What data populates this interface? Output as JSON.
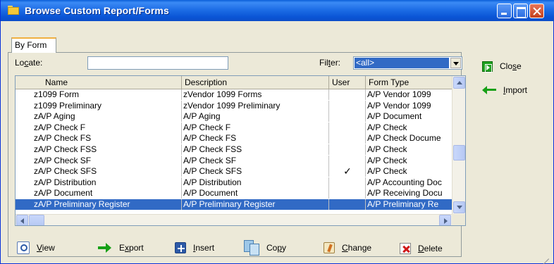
{
  "window": {
    "title": "Browse Custom Report/Forms"
  },
  "tabs": [
    {
      "label": "By Form"
    }
  ],
  "locate": {
    "label_pre": "Lo",
    "label_u": "c",
    "label_post": "ate:",
    "value": ""
  },
  "filter": {
    "label_pre": "Fil",
    "label_u": "t",
    "label_post": "er:",
    "value": "<all>"
  },
  "grid": {
    "columns": [
      "Name",
      "Description",
      "User",
      "Form Type"
    ],
    "rows": [
      {
        "name": "z1099 Form",
        "description": "zVendor 1099 Forms",
        "user": "",
        "form_type": "A/P Vendor 1099"
      },
      {
        "name": "z1099 Preliminary",
        "description": "zVendor 1099 Preliminary",
        "user": "",
        "form_type": "A/P Vendor 1099"
      },
      {
        "name": "zA/P Aging",
        "description": "A/P Aging",
        "user": "",
        "form_type": "A/P Document"
      },
      {
        "name": "zA/P Check F",
        "description": "A/P Check F",
        "user": "",
        "form_type": "A/P Check"
      },
      {
        "name": "zA/P Check FS",
        "description": "A/P Check FS",
        "user": "",
        "form_type": "A/P Check Docume"
      },
      {
        "name": "zA/P Check FSS",
        "description": "A/P Check FSS",
        "user": "",
        "form_type": "A/P Check"
      },
      {
        "name": "zA/P Check SF",
        "description": "A/P Check SF",
        "user": "",
        "form_type": "A/P Check"
      },
      {
        "name": "zA/P Check SFS",
        "description": "A/P Check SFS",
        "user": "✓",
        "form_type": "A/P Check"
      },
      {
        "name": "zA/P Distribution",
        "description": "A/P Distribution",
        "user": "",
        "form_type": "A/P Accounting Doc"
      },
      {
        "name": "zA/P Document",
        "description": "A/P Document",
        "user": "",
        "form_type": "A/P Receiving Docu"
      },
      {
        "name": "zA/P Preliminary Register",
        "description": "A/P Preliminary Register",
        "user": "",
        "form_type": "A/P Preliminary Re"
      }
    ],
    "selected_index": 10
  },
  "buttons": {
    "view": {
      "u": "V",
      "rest": "iew"
    },
    "export": {
      "pre": "E",
      "u": "x",
      "rest": "port"
    },
    "insert": {
      "u": "I",
      "rest": "nsert"
    },
    "copy": {
      "pre": "Co",
      "u": "p",
      "rest": "y"
    },
    "change": {
      "u": "C",
      "rest": "hange"
    },
    "delete": {
      "u": "D",
      "rest": "elete"
    },
    "close": {
      "pre": "Clo",
      "u": "s",
      "rest": "e"
    },
    "import": {
      "u": "I",
      "rest": "mport"
    }
  },
  "colors": {
    "title_bar": "#0a55d6",
    "selection": "#316ac5",
    "window_bg": "#ece9d8"
  },
  "icons": [
    "folder-icon",
    "minimize-icon",
    "maximize-icon",
    "close-window-icon",
    "view-icon",
    "export-arrow-icon",
    "insert-plus-icon",
    "copy-icon",
    "change-icon",
    "delete-x-icon",
    "close-door-icon",
    "import-arrow-icon"
  ]
}
